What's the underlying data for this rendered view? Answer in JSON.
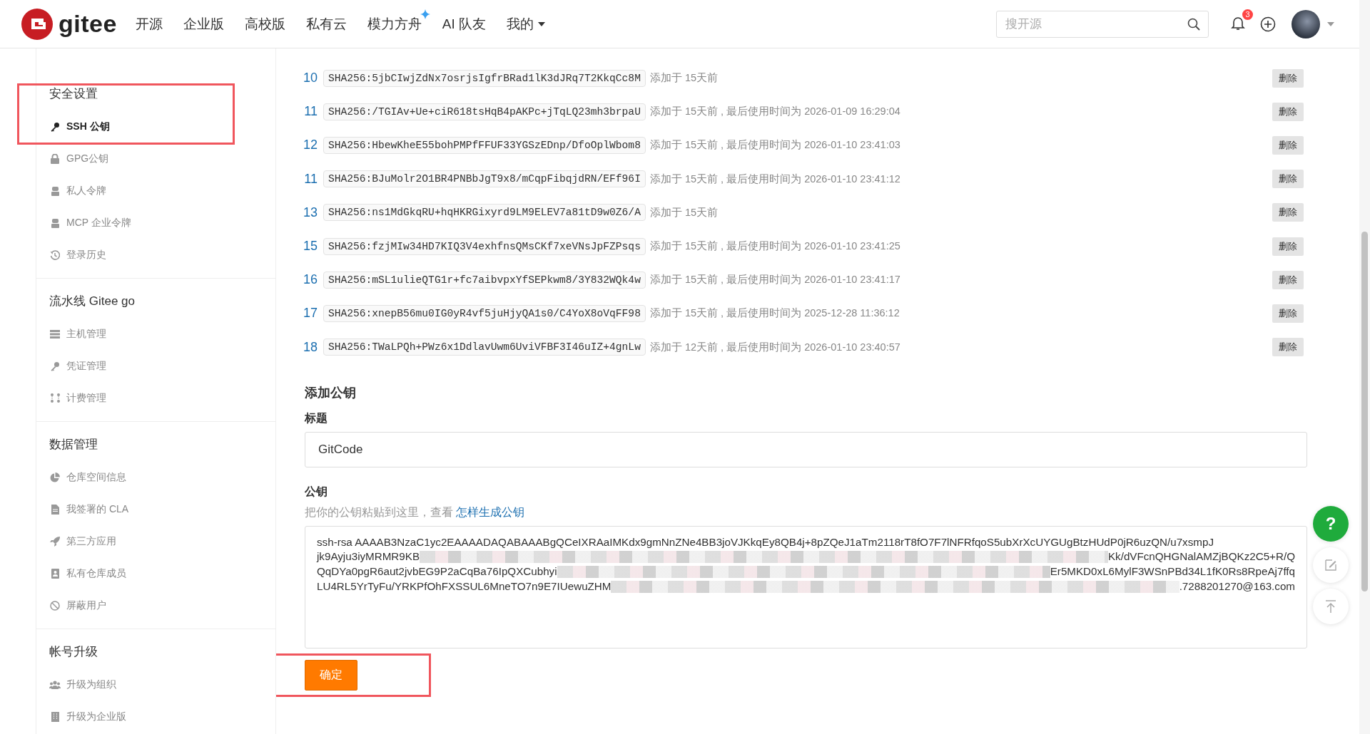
{
  "nav": {
    "logo": "gitee",
    "items": [
      {
        "label": "开源",
        "kind": "link"
      },
      {
        "label": "企业版",
        "kind": "link"
      },
      {
        "label": "高校版",
        "kind": "link"
      },
      {
        "label": "私有云",
        "kind": "link"
      },
      {
        "label": "模力方舟",
        "kind": "sparkle"
      },
      {
        "label": "AI 队友",
        "kind": "link"
      },
      {
        "label": "我的",
        "kind": "dropdown"
      }
    ]
  },
  "search": {
    "placeholder": "搜开源"
  },
  "notifications": {
    "count": "3"
  },
  "sidebar": {
    "sections": [
      {
        "title": "安全设置",
        "highlighted": true,
        "items": [
          {
            "label": "SSH 公钥",
            "kind": "key",
            "selected": true
          },
          {
            "label": "GPG公钥",
            "kind": "lock",
            "selected": false
          },
          {
            "label": "私人令牌",
            "kind": "robot",
            "selected": false
          },
          {
            "label": "MCP 企业令牌",
            "kind": "robot",
            "selected": false
          },
          {
            "label": "登录历史",
            "kind": "history",
            "selected": false
          }
        ]
      },
      {
        "title": "流水线 Gitee go",
        "highlighted": false,
        "items": [
          {
            "label": "主机管理",
            "kind": "server",
            "selected": false
          },
          {
            "label": "凭证管理",
            "kind": "key",
            "selected": false
          },
          {
            "label": "计费管理",
            "kind": "dots",
            "selected": false
          }
        ]
      },
      {
        "title": "数据管理",
        "highlighted": false,
        "items": [
          {
            "label": "仓库空间信息",
            "kind": "pie",
            "selected": false
          },
          {
            "label": "我签署的 CLA",
            "kind": "doc",
            "selected": false
          },
          {
            "label": "第三方应用",
            "kind": "rocket",
            "selected": false
          },
          {
            "label": "私有仓库成员",
            "kind": "badge",
            "selected": false
          },
          {
            "label": "屏蔽用户",
            "kind": "ban",
            "selected": false
          }
        ]
      },
      {
        "title": "帐号升级",
        "highlighted": false,
        "items": [
          {
            "label": "升级为组织",
            "kind": "users",
            "selected": false
          },
          {
            "label": "升级为企业版",
            "kind": "building",
            "selected": false
          }
        ]
      }
    ]
  },
  "keys": [
    {
      "index": "10",
      "fingerprint": "SHA256:5jbCIwjZdNx7osrjsIgfrBRad1lK3dJRq7T2KkqCc8M",
      "info": "添加于 15天前",
      "action": "删除"
    },
    {
      "index": "11",
      "fingerprint": "SHA256:/TGIAv+Ue+ciR618tsHqB4pAKPc+jTqLQ23mh3brpaU",
      "info": "添加于 15天前 , 最后使用时间为 2026-01-09 16:29:04",
      "action": "删除"
    },
    {
      "index": "12",
      "fingerprint": "SHA256:HbewKheE55bohPMPfFFUF33YGSzEDnp/DfoOplWbom8",
      "info": "添加于 15天前 , 最后使用时间为 2026-01-10 23:41:03",
      "action": "删除"
    },
    {
      "index": "11",
      "fingerprint": "SHA256:BJuMolr2O1BR4PNBbJgT9x8/mCqpFibqjdRN/EFf96I",
      "info": "添加于 15天前 , 最后使用时间为 2026-01-10 23:41:12",
      "action": "删除"
    },
    {
      "index": "13",
      "fingerprint": "SHA256:ns1MdGkqRU+hqHKRGixyrd9LM9ELEV7a81tD9w0Z6/A",
      "info": "添加于 15天前",
      "action": "删除"
    },
    {
      "index": "15",
      "fingerprint": "SHA256:fzjMIw34HD7KIQ3V4exhfnsQMsCKf7xeVNsJpFZPsqs",
      "info": "添加于 15天前 , 最后使用时间为 2026-01-10 23:41:25",
      "action": "删除"
    },
    {
      "index": "16",
      "fingerprint": "SHA256:mSL1ulieQTG1r+fc7aibvpxYfSEPkwm8/3Y832WQk4w",
      "info": "添加于 15天前 , 最后使用时间为 2026-01-10 23:41:17",
      "action": "删除"
    },
    {
      "index": "17",
      "fingerprint": "SHA256:xnepB56mu0IG0yR4vf5juHjyQA1s0/C4YoX8oVqFF98",
      "info": "添加于 15天前 , 最后使用时间为 2025-12-28 11:36:12",
      "action": "删除"
    },
    {
      "index": "18",
      "fingerprint": "SHA256:TWaLPQh+PWz6x1DdlavUwm6UviVFBF3I46uIZ+4gnLw",
      "info": "添加于 12天前 , 最后使用时间为 2026-01-10 23:40:57",
      "action": "删除"
    }
  ],
  "add_key": {
    "title": "添加公钥",
    "name_label": "标题",
    "name_value": "GitCode",
    "key_label": "公钥",
    "hint": "把你的公钥粘贴到这里，查看",
    "hint_link": "怎样生成公钥",
    "key_lines": [
      {
        "start": "ssh-rsa AAAAB3NzaC1yc2EAAAADAQABAAABgQCeIXRAaIMKdx9gmNnZNe4BB3joVJKkqEy8QB4j+8pZQeJ1aTm2118rT8fO7F7lNFRfqoS5ubXrXcUYGUgBtzHUdP0jR6uzQN/u7xsmpJ",
        "blurred": false
      },
      {
        "start": "jk9Ayju3iyMRMR9KB",
        "end": "Kk/dVFcnQHGNalAMZjBQKz2C5+R/Q",
        "blurred": true
      },
      {
        "start": "QqDYa0pgR6aut2jvbEG9P2aCqBa76IpQXCubhyi",
        "end": "Er5MKD0xL6MylF3WSnPBd34L1fK0Rs8RpeAj7ffq",
        "blurred": true
      },
      {
        "start": "LU4RL5YrTyFu/YRKPfOhFXSSUL6MneTO7n9E7IUewuZHM",
        "end": ".7288201270@163.com",
        "blurred": true
      }
    ],
    "submit": {
      "label": "确定",
      "highlighted": true
    }
  },
  "float_buttons": [
    {
      "kind": "help",
      "label": "?"
    },
    {
      "kind": "edit"
    },
    {
      "kind": "top"
    }
  ]
}
